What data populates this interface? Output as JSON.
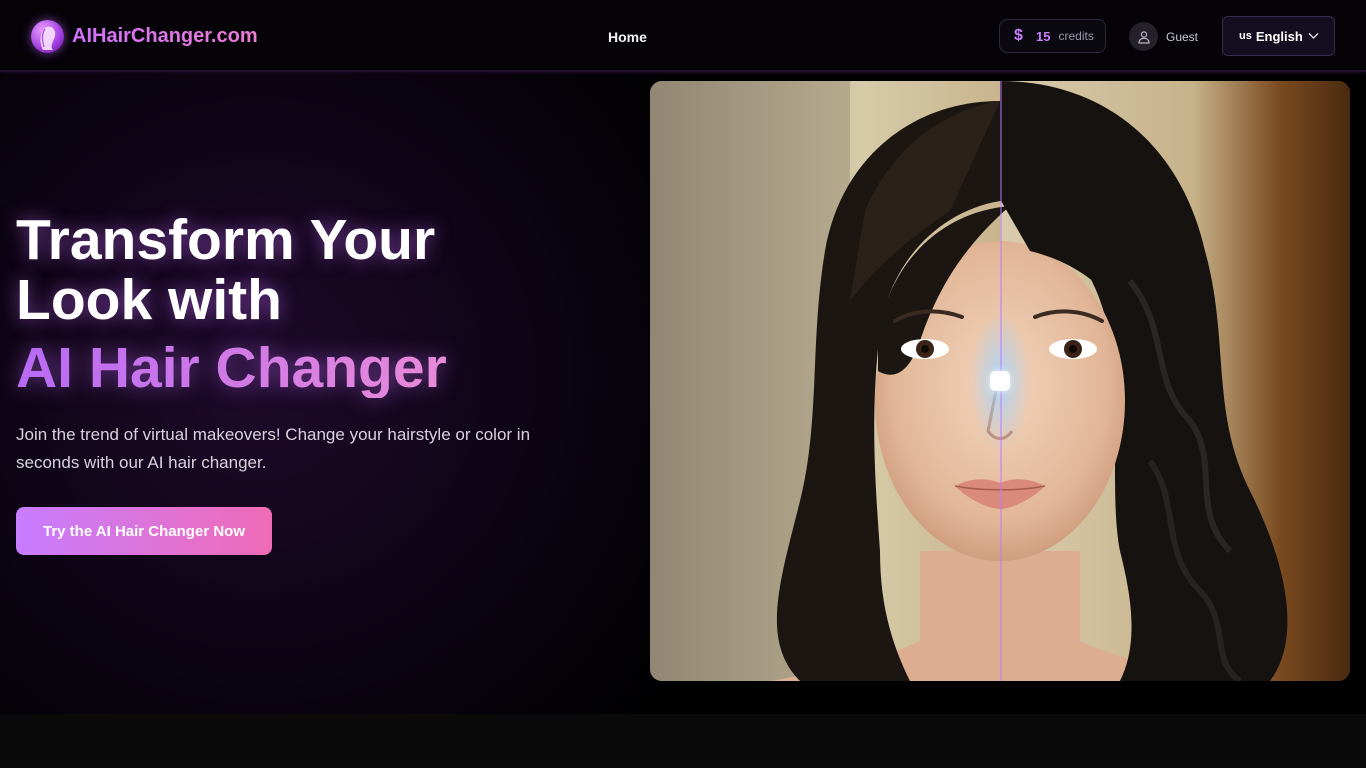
{
  "header": {
    "brand": "AIHairChanger.com",
    "nav": {
      "home": "Home"
    },
    "credits": {
      "symbol": "$",
      "count": "15",
      "label": "credits"
    },
    "user": {
      "name": "Guest"
    },
    "language": {
      "flag": "us",
      "label": "English"
    }
  },
  "hero": {
    "title_line1": "Transform Your",
    "title_line2": "Look with",
    "title_accent": "AI Hair Changer",
    "subtitle": "Join the trend of virtual makeovers! Change your hairstyle or color in seconds with our AI hair changer.",
    "cta_label": "Try the AI Hair Changer Now"
  },
  "comparison": {
    "slider_position": 0.5
  },
  "colors": {
    "accent_purple": "#c77dff",
    "accent_pink": "#f06bb6",
    "background": "#000000"
  },
  "icons": [
    "brand-logo-icon",
    "dollar-icon",
    "user-icon",
    "chevron-down-icon"
  ]
}
